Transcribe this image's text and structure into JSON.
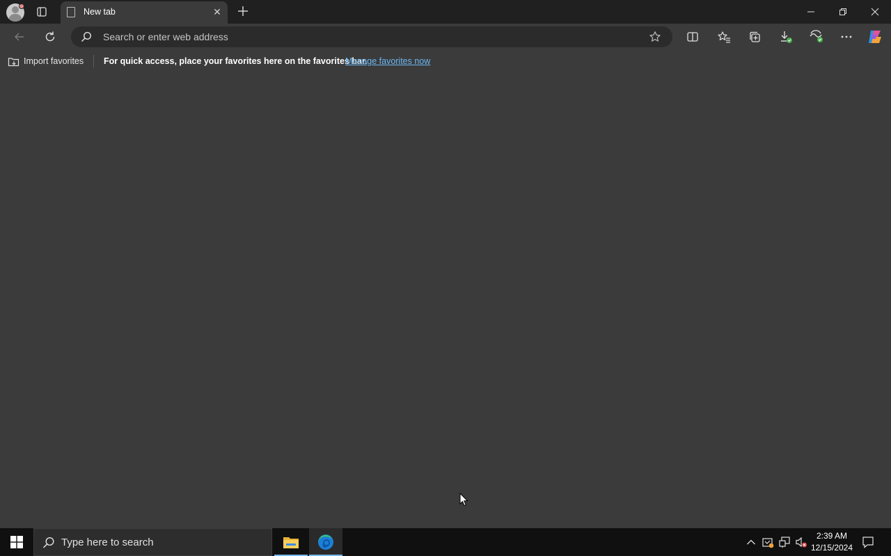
{
  "browser": {
    "tab": {
      "title": "New tab"
    },
    "address_bar": {
      "placeholder": "Search or enter web address",
      "value": ""
    },
    "favorites_bar": {
      "import_label": "Import favorites",
      "message": "For quick access, place your favorites here on the favorites bar.",
      "link": "Manage favorites now"
    },
    "colors": {
      "background": "#3b3b3b",
      "titlebar": "#202020",
      "link": "#6cb8f5"
    },
    "toolbar_icons": [
      "back-icon",
      "refresh-icon",
      "split-screen-icon",
      "favorites-icon",
      "collections-icon",
      "downloads-icon",
      "browser-essentials-icon",
      "more-icon",
      "copilot-icon"
    ]
  },
  "taskbar": {
    "search_placeholder": "Type here to search",
    "apps": [
      "file-explorer-icon",
      "edge-icon"
    ],
    "clock": {
      "time": "2:39 AM",
      "date": "12/15/2024"
    }
  }
}
